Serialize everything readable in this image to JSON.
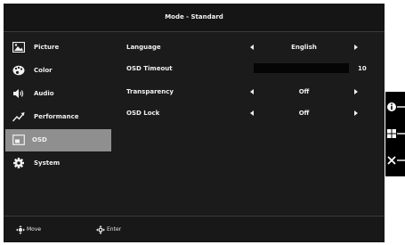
{
  "window": {
    "title": "Mode - Standard"
  },
  "sidebar": {
    "items": [
      {
        "label": "Picture",
        "icon": "picture-icon",
        "active": false
      },
      {
        "label": "Color",
        "icon": "color-palette-icon",
        "active": false
      },
      {
        "label": "Audio",
        "icon": "speaker-icon",
        "active": false
      },
      {
        "label": "Performance",
        "icon": "performance-icon",
        "active": false
      },
      {
        "label": "OSD",
        "icon": "osd-icon",
        "active": true
      },
      {
        "label": "System",
        "icon": "gear-icon",
        "active": false
      }
    ]
  },
  "settings": {
    "language": {
      "label": "Language",
      "value": "English"
    },
    "osd_timeout": {
      "label": "OSD Timeout",
      "value": "10"
    },
    "transparency": {
      "label": "Transparency",
      "value": "Off"
    },
    "osd_lock": {
      "label": "OSD Lock",
      "value": "Off"
    }
  },
  "footer": {
    "move_label": "Move",
    "enter_label": "Enter"
  },
  "hotkeys": [
    "info-icon",
    "grid-icon",
    "close-icon"
  ],
  "colors": {
    "background": "#1b1b1b",
    "active_item": "#8f8f8f",
    "text": "#f0f0f0"
  }
}
